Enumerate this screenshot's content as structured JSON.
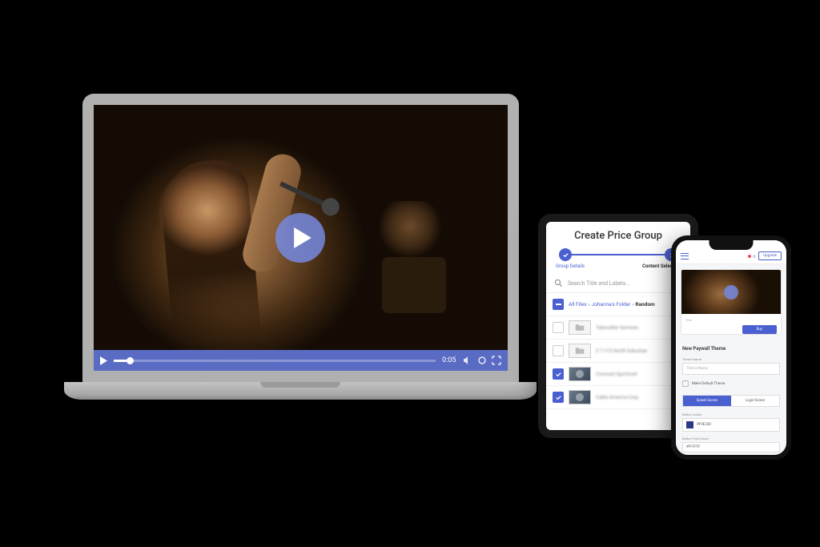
{
  "colors": {
    "accent": "#4a5fd0",
    "button_colour_value": "#2a3a8a"
  },
  "laptop": {
    "video_time": "0:05"
  },
  "tablet": {
    "title": "Create Price Group",
    "step1_label": "Group Details",
    "step2_label": "Content Selection",
    "search_placeholder": "Search Title and Labels...",
    "breadcrumb": {
      "p1": "All Files",
      "sep": "›",
      "p2": "Johanna's Folder",
      "p3": "Random"
    },
    "rows": [
      {
        "checked": false,
        "type": "folder",
        "label": "Telecrafter Services"
      },
      {
        "checked": false,
        "type": "folder",
        "label": "C T V13 North Suburban"
      },
      {
        "checked": true,
        "type": "video",
        "label": "Comcast Sportsnet"
      },
      {
        "checked": true,
        "type": "video",
        "label": "Cable America Corp"
      }
    ]
  },
  "phone": {
    "upgrade": "Upgrade",
    "thumb_title": "Title",
    "buy": "Buy",
    "section_title": "New Paywall Theme",
    "theme_name_label": "Theme Name",
    "theme_name_placeholder": "Theme Name",
    "make_default": "Make Default Theme",
    "tab_splash": "Splash Screen",
    "tab_login": "Login Screen",
    "button_colour_label": "Button Colour",
    "button_colour_value": "#F9E330",
    "button_text_colour_label": "Button Text Colour",
    "button_text_colour_value": "#FFFFFF"
  }
}
